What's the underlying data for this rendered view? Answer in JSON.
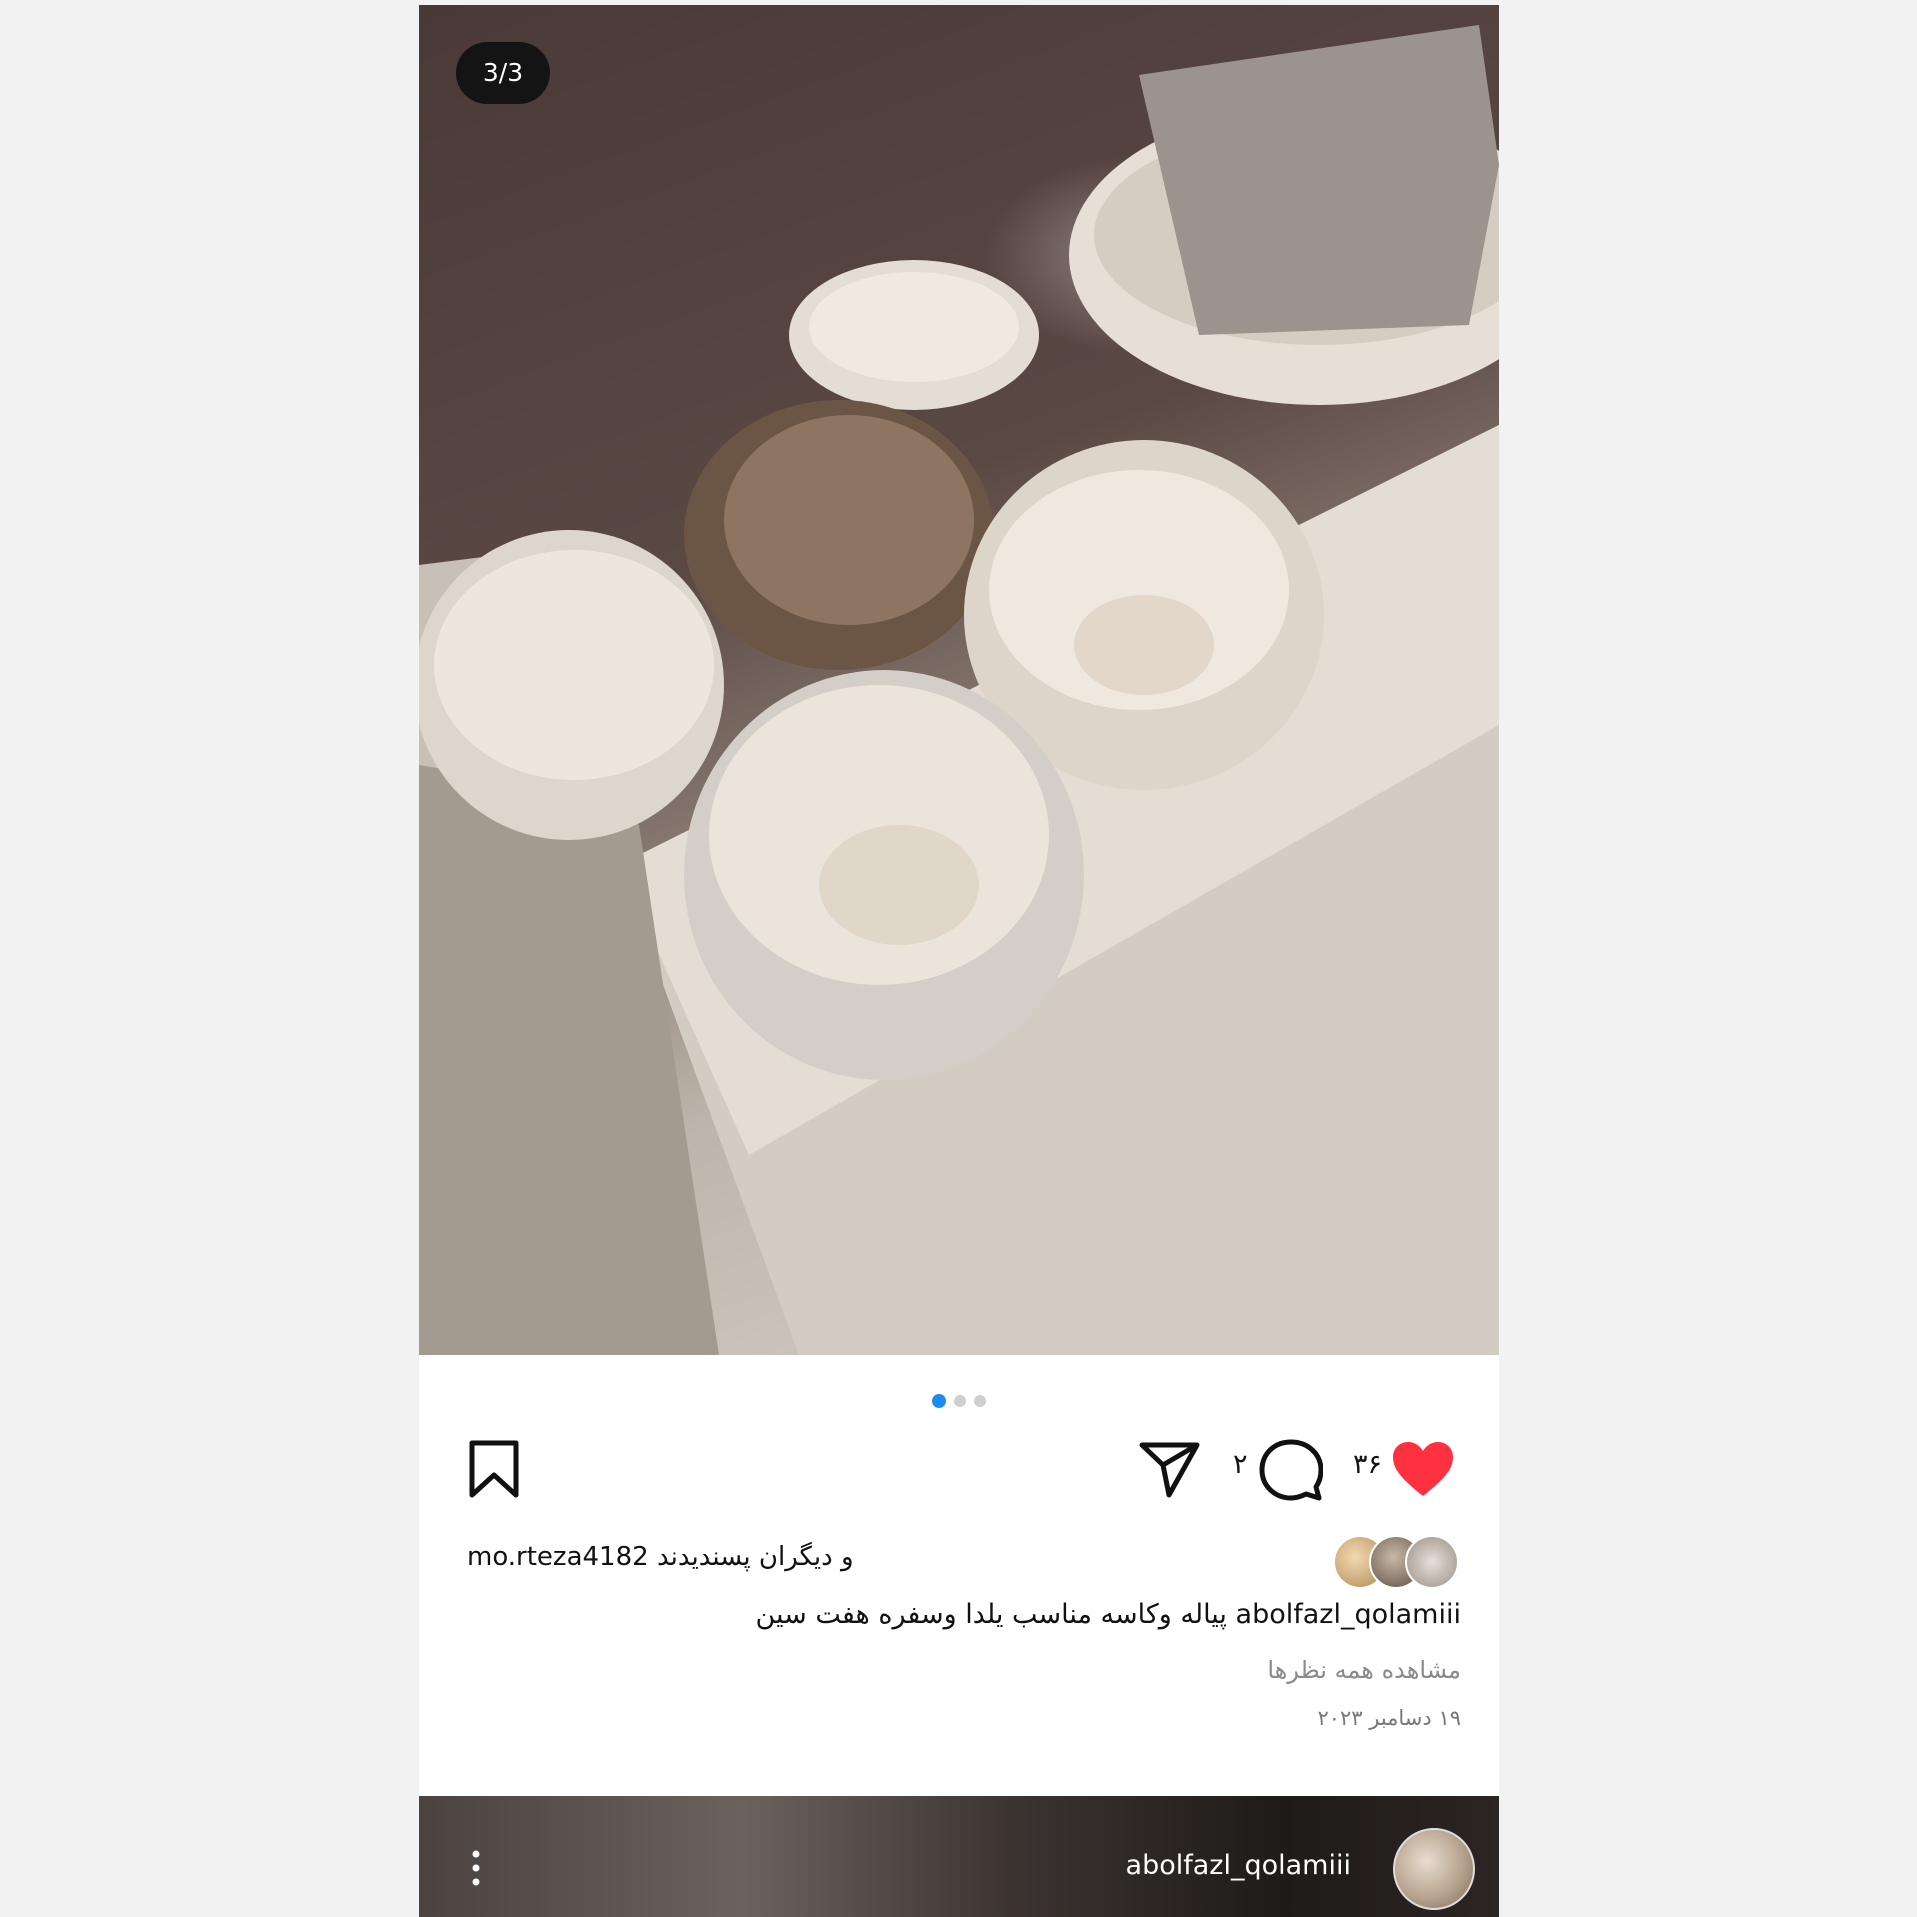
{
  "post": {
    "image_counter": "3/3",
    "likes_count": "۳۶",
    "comments_count": "۲",
    "liked_by": "mo.rteza4182 و دیگران پسندیدند",
    "caption_user": "abolfazl_qolamiii",
    "caption_text": "پیاله وکاسه مناسب یلدا وسفره هفت سین",
    "view_all_comments": "مشاهده همه نظرها",
    "date": "۱۹ دسامبر ۲۰۲۳",
    "carousel_total": 3,
    "carousel_active": 1
  },
  "next_post": {
    "username": "abolfazl_qolamiii"
  },
  "colors": {
    "heart": "#ff3040",
    "active_dot": "#1a8cf0"
  },
  "icons": [
    "heart-icon",
    "comment-icon",
    "share-icon",
    "bookmark-icon",
    "more-icon"
  ]
}
